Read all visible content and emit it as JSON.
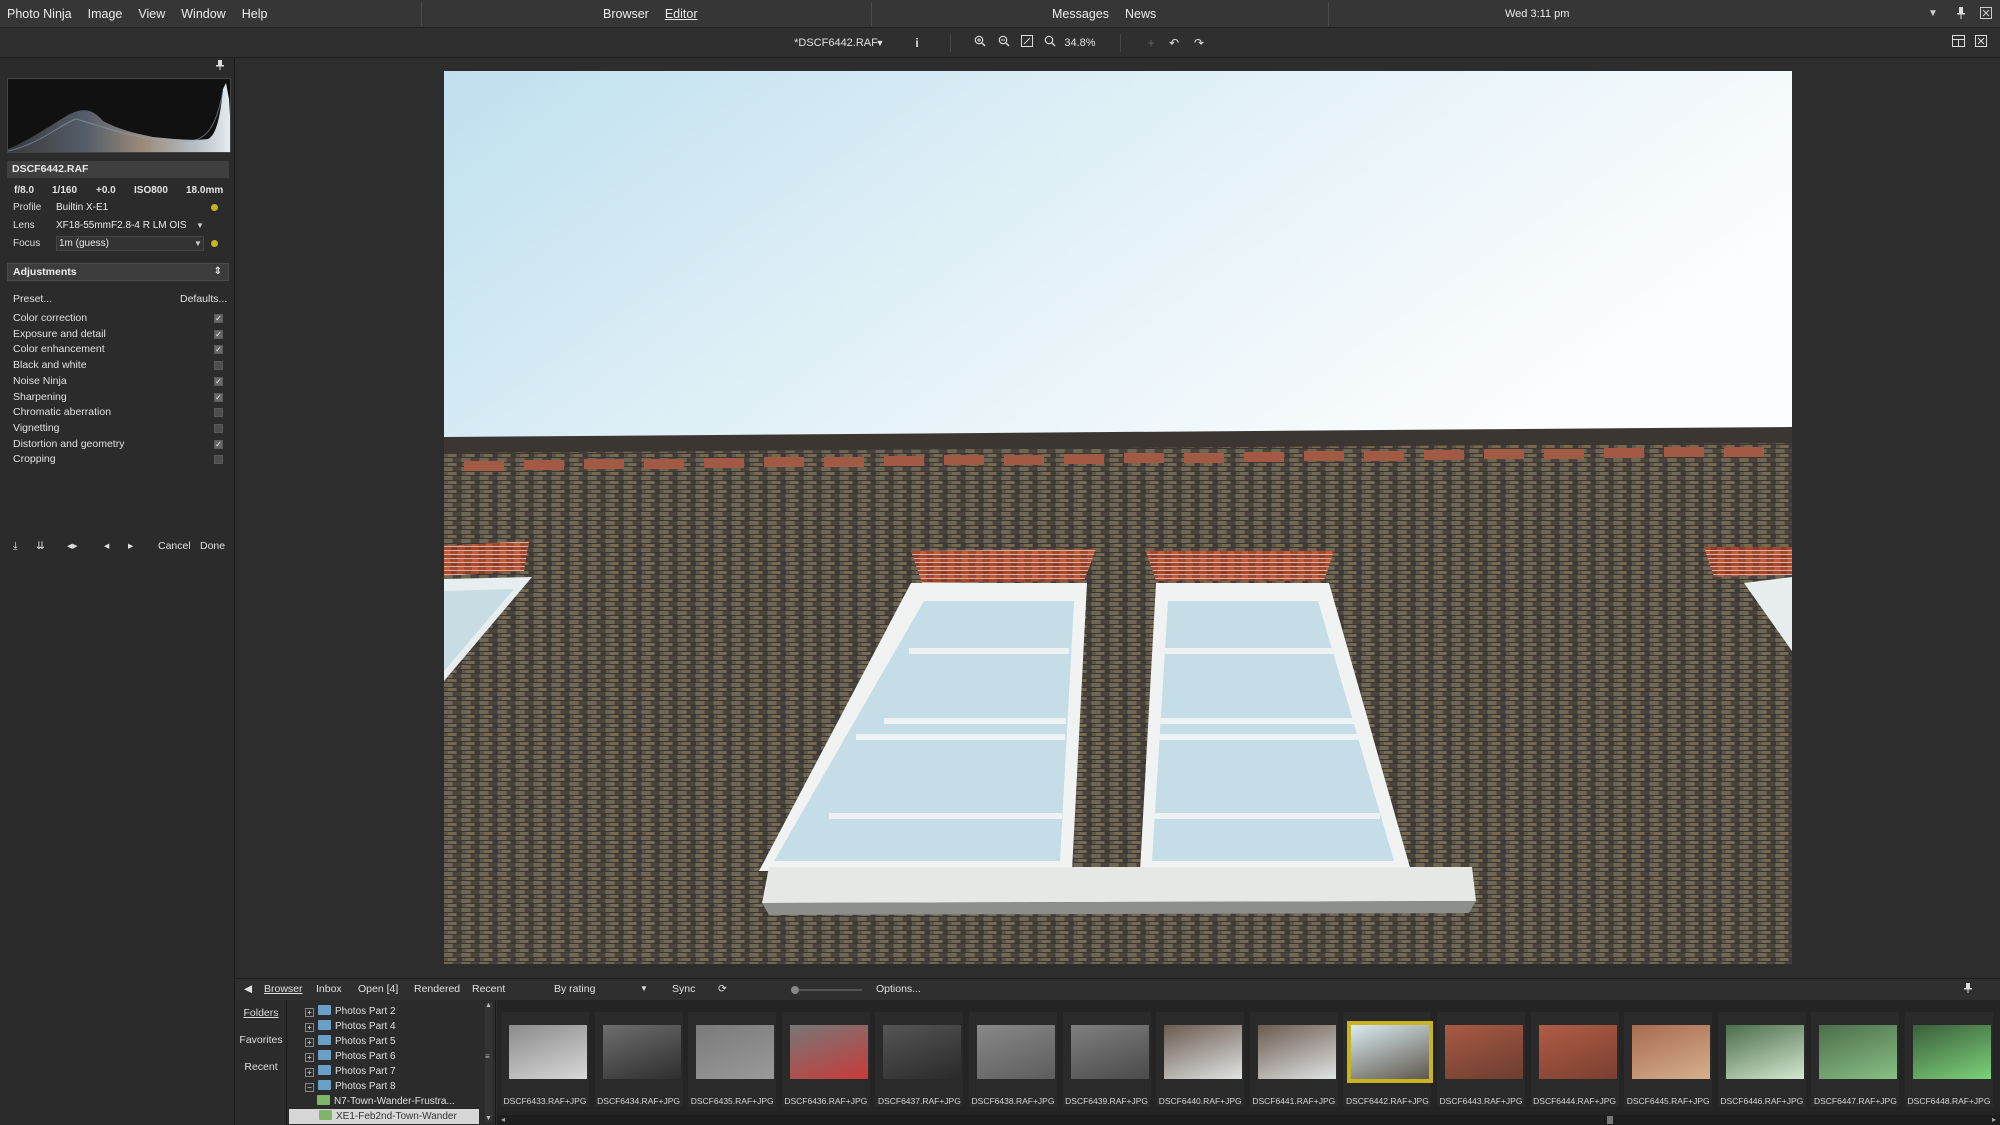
{
  "menubar": {
    "app_name": "Photo Ninja",
    "menu": [
      "Image",
      "View",
      "Window",
      "Help"
    ],
    "modes": [
      "Browser",
      "Editor"
    ],
    "messages": [
      "Messages",
      "News"
    ],
    "clock": "Wed 3:11 pm"
  },
  "toolbar": {
    "filename": "*DSCF6442.RAF",
    "zoom": "34.8%"
  },
  "left": {
    "file": "DSCF6442.RAF",
    "exif": [
      "f/8.0",
      "1/160",
      "+0.0",
      "ISO800",
      "18.0mm"
    ],
    "profile_label": "Profile",
    "profile_value": "Builtin X-E1",
    "lens_label": "Lens",
    "lens_value": "XF18-55mmF2.8-4 R LM OIS",
    "focus_label": "Focus",
    "focus_value": "1m (guess)",
    "adjustments_title": "Adjustments",
    "preset": "Preset...",
    "defaults": "Defaults...",
    "adjustments": [
      {
        "label": "Color correction",
        "checked": true
      },
      {
        "label": "Exposure and detail",
        "checked": true
      },
      {
        "label": "Color enhancement",
        "checked": true
      },
      {
        "label": "Black and white",
        "checked": false
      },
      {
        "label": "Noise Ninja",
        "checked": true
      },
      {
        "label": "Sharpening",
        "checked": true
      },
      {
        "label": "Chromatic aberration",
        "checked": false
      },
      {
        "label": "Vignetting",
        "checked": false
      },
      {
        "label": "Distortion and geometry",
        "checked": true
      },
      {
        "label": "Cropping",
        "checked": false
      }
    ],
    "cancel": "Cancel",
    "done": "Done"
  },
  "browser": {
    "tabs": [
      "Browser",
      "Inbox",
      "Open [4]",
      "Rendered",
      "Recent"
    ],
    "sort": "By rating",
    "sync": "Sync",
    "options": "Options...",
    "side": [
      "Folders",
      "Favorites",
      "Recent"
    ],
    "folders": [
      "Photos Part 2",
      "Photos Part 4",
      "Photos Part 5",
      "Photos Part 6",
      "Photos Part 7",
      "Photos Part 8",
      "N7-Town-Wander-Frustra...",
      "XE1-Feb2nd-Town-Wander"
    ],
    "thumbs": [
      "DSCF6433.RAF+JPG",
      "DSCF6434.RAF+JPG",
      "DSCF6435.RAF+JPG",
      "DSCF6436.RAF+JPG",
      "DSCF6437.RAF+JPG",
      "DSCF6438.RAF+JPG",
      "DSCF6439.RAF+JPG",
      "DSCF6440.RAF+JPG",
      "DSCF6441.RAF+JPG",
      "DSCF6442.RAF+JPG",
      "DSCF6443.RAF+JPG",
      "DSCF6444.RAF+JPG",
      "DSCF6445.RAF+JPG",
      "DSCF6446.RAF+JPG",
      "DSCF6447.RAF+JPG",
      "DSCF6448.RAF+JPG"
    ],
    "selected_thumb": 9
  },
  "colors": {
    "accent": "#c8b41e",
    "sky": "#d6ecf5",
    "brick": "#5a5347"
  }
}
